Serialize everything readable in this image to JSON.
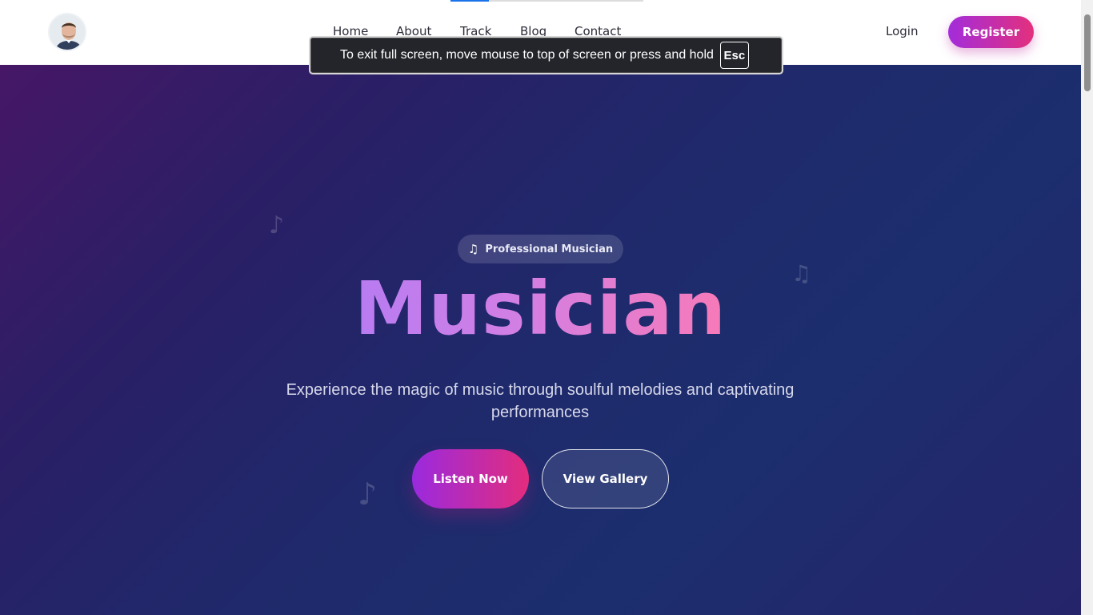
{
  "header": {
    "avatar_alt": "profile-avatar",
    "nav": {
      "home": "Home",
      "about": "About",
      "track": "Track",
      "blog": "Blog",
      "contact": "Contact"
    },
    "scroll_progress": 0.2,
    "login_label": "Login",
    "register_label": "Register",
    "register_gradient": [
      "#a32cdb",
      "#e3307d"
    ]
  },
  "toast": {
    "message": "To exit full screen, move mouse to top of screen or press and hold",
    "key": "Esc"
  },
  "hero": {
    "badge_icon": "music-note-icon",
    "badge_label": "Professional Musician",
    "title": "Musician",
    "subtitle": "Experience the magic of music through soulful melodies and captivating performances",
    "listen_label": "Listen Now",
    "gallery_label": "View Gallery",
    "decorations": [
      "music-note-icon",
      "music-note-icon",
      "music-note-icon"
    ]
  },
  "colors": {
    "accent": "#a32cdb",
    "accent_pink": "#e3307d",
    "hero_bg": "#1f296b"
  }
}
